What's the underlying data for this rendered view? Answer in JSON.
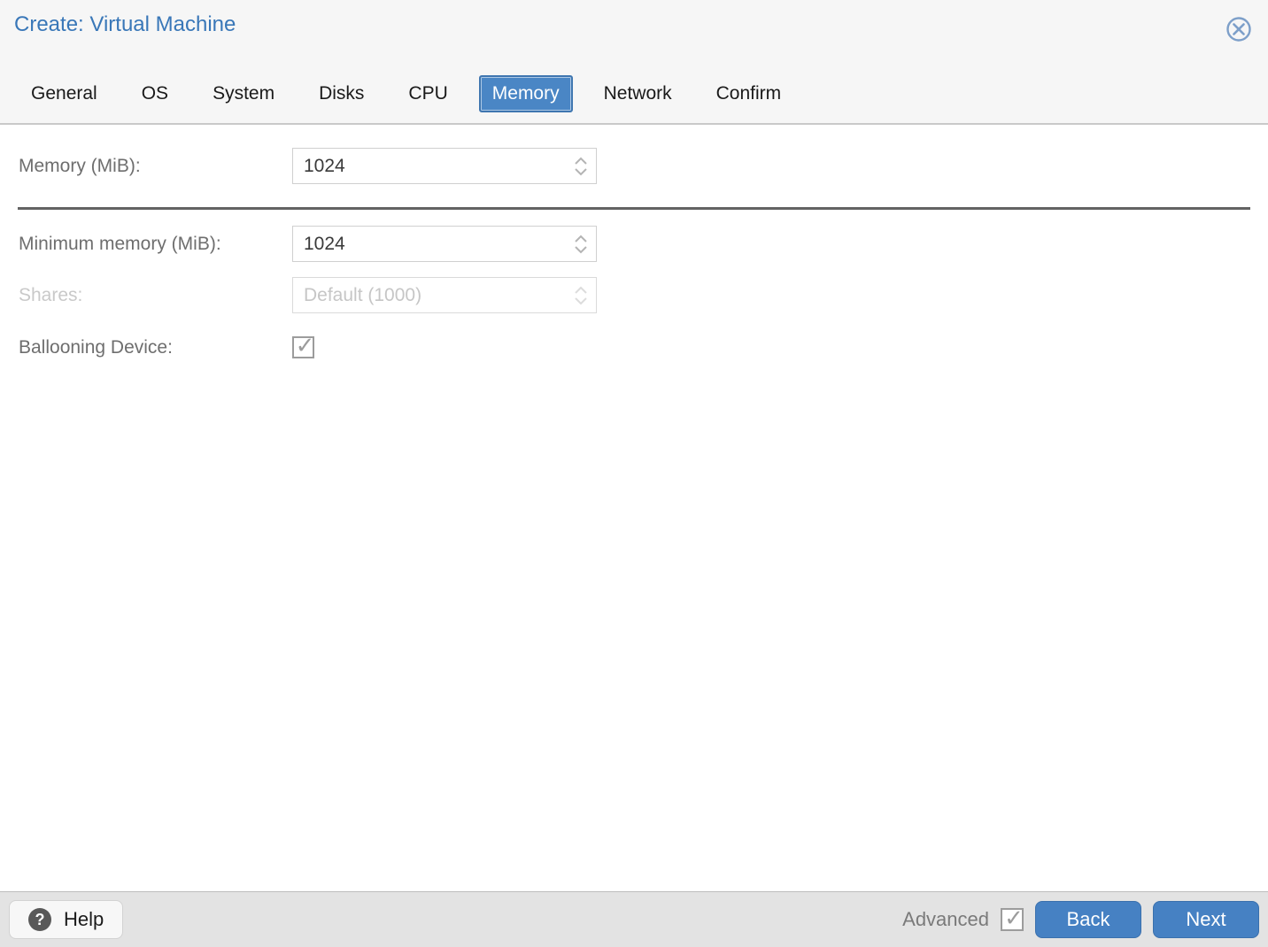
{
  "window": {
    "title": "Create: Virtual Machine"
  },
  "tabs": [
    {
      "label": "General",
      "active": false
    },
    {
      "label": "OS",
      "active": false
    },
    {
      "label": "System",
      "active": false
    },
    {
      "label": "Disks",
      "active": false
    },
    {
      "label": "CPU",
      "active": false
    },
    {
      "label": "Memory",
      "active": true
    },
    {
      "label": "Network",
      "active": false
    },
    {
      "label": "Confirm",
      "active": false
    }
  ],
  "form": {
    "memory": {
      "label": "Memory (MiB):",
      "value": "1024"
    },
    "min_memory": {
      "label": "Minimum memory (MiB):",
      "value": "1024"
    },
    "shares": {
      "label": "Shares:",
      "placeholder": "Default (1000)",
      "disabled": true
    },
    "ballooning": {
      "label": "Ballooning Device:",
      "checked": true
    }
  },
  "footer": {
    "help_label": "Help",
    "advanced_label": "Advanced",
    "advanced_checked": true,
    "back_label": "Back",
    "next_label": "Next"
  },
  "icons": {
    "question": "?",
    "check": "✓"
  },
  "colors": {
    "title_blue": "#3977b8",
    "active_tab_blue": "#4a86c5",
    "button_blue": "#4681c3",
    "divider_gray": "#636363",
    "label_gray": "#6e6e6e",
    "disabled_gray": "#c9c9c9"
  }
}
